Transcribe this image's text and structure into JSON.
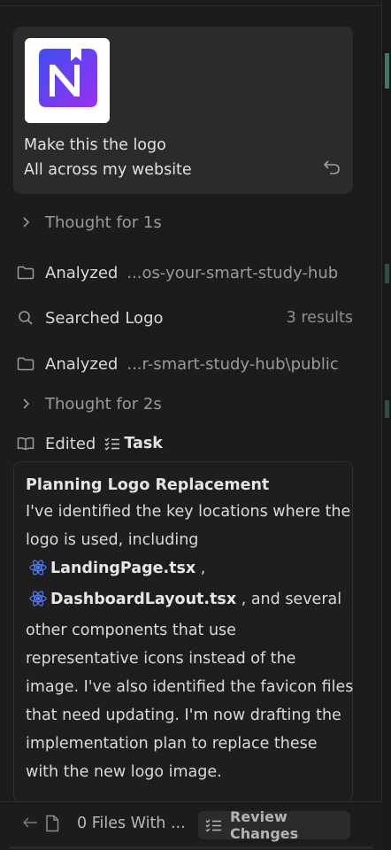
{
  "user_message": {
    "line1": "Make this the logo",
    "line2": "All across my website",
    "logo_colors": [
      "#3d4ff0",
      "#9b2ff0"
    ]
  },
  "steps": {
    "thought1": "Thought for 1s",
    "analyzed1": {
      "label": "Analyzed",
      "path": "...os-your-smart-study-hub"
    },
    "searched": {
      "label": "Searched",
      "query": "Logo",
      "count": "3 results"
    },
    "analyzed2": {
      "label": "Analyzed",
      "path": "...r-smart-study-hub\\public"
    },
    "thought2": "Thought for 2s",
    "edited": {
      "label": "Edited",
      "target": "Task"
    }
  },
  "task": {
    "title": "Planning Logo Replacement",
    "line1": "I've identified the key locations where the",
    "line2": "logo is used, including",
    "file1": "LandingPage.tsx",
    "file1_suffix": ",",
    "file2": "DashboardLayout.tsx",
    "file2_suffix": ", and several",
    "line5": "other components that use",
    "line6": "representative icons instead of the",
    "line7": "image. I've also identified the favicon files",
    "line8": "that need updating. I'm now drafting the",
    "line9": "implementation plan to replace these",
    "line10": "with the new logo image."
  },
  "bottom": {
    "files": "0 Files With ...",
    "review": "Review Changes"
  },
  "colors": {
    "background": "#1c1c1c",
    "card": "#2b2b2b",
    "react_icon": "#4f7df5"
  }
}
